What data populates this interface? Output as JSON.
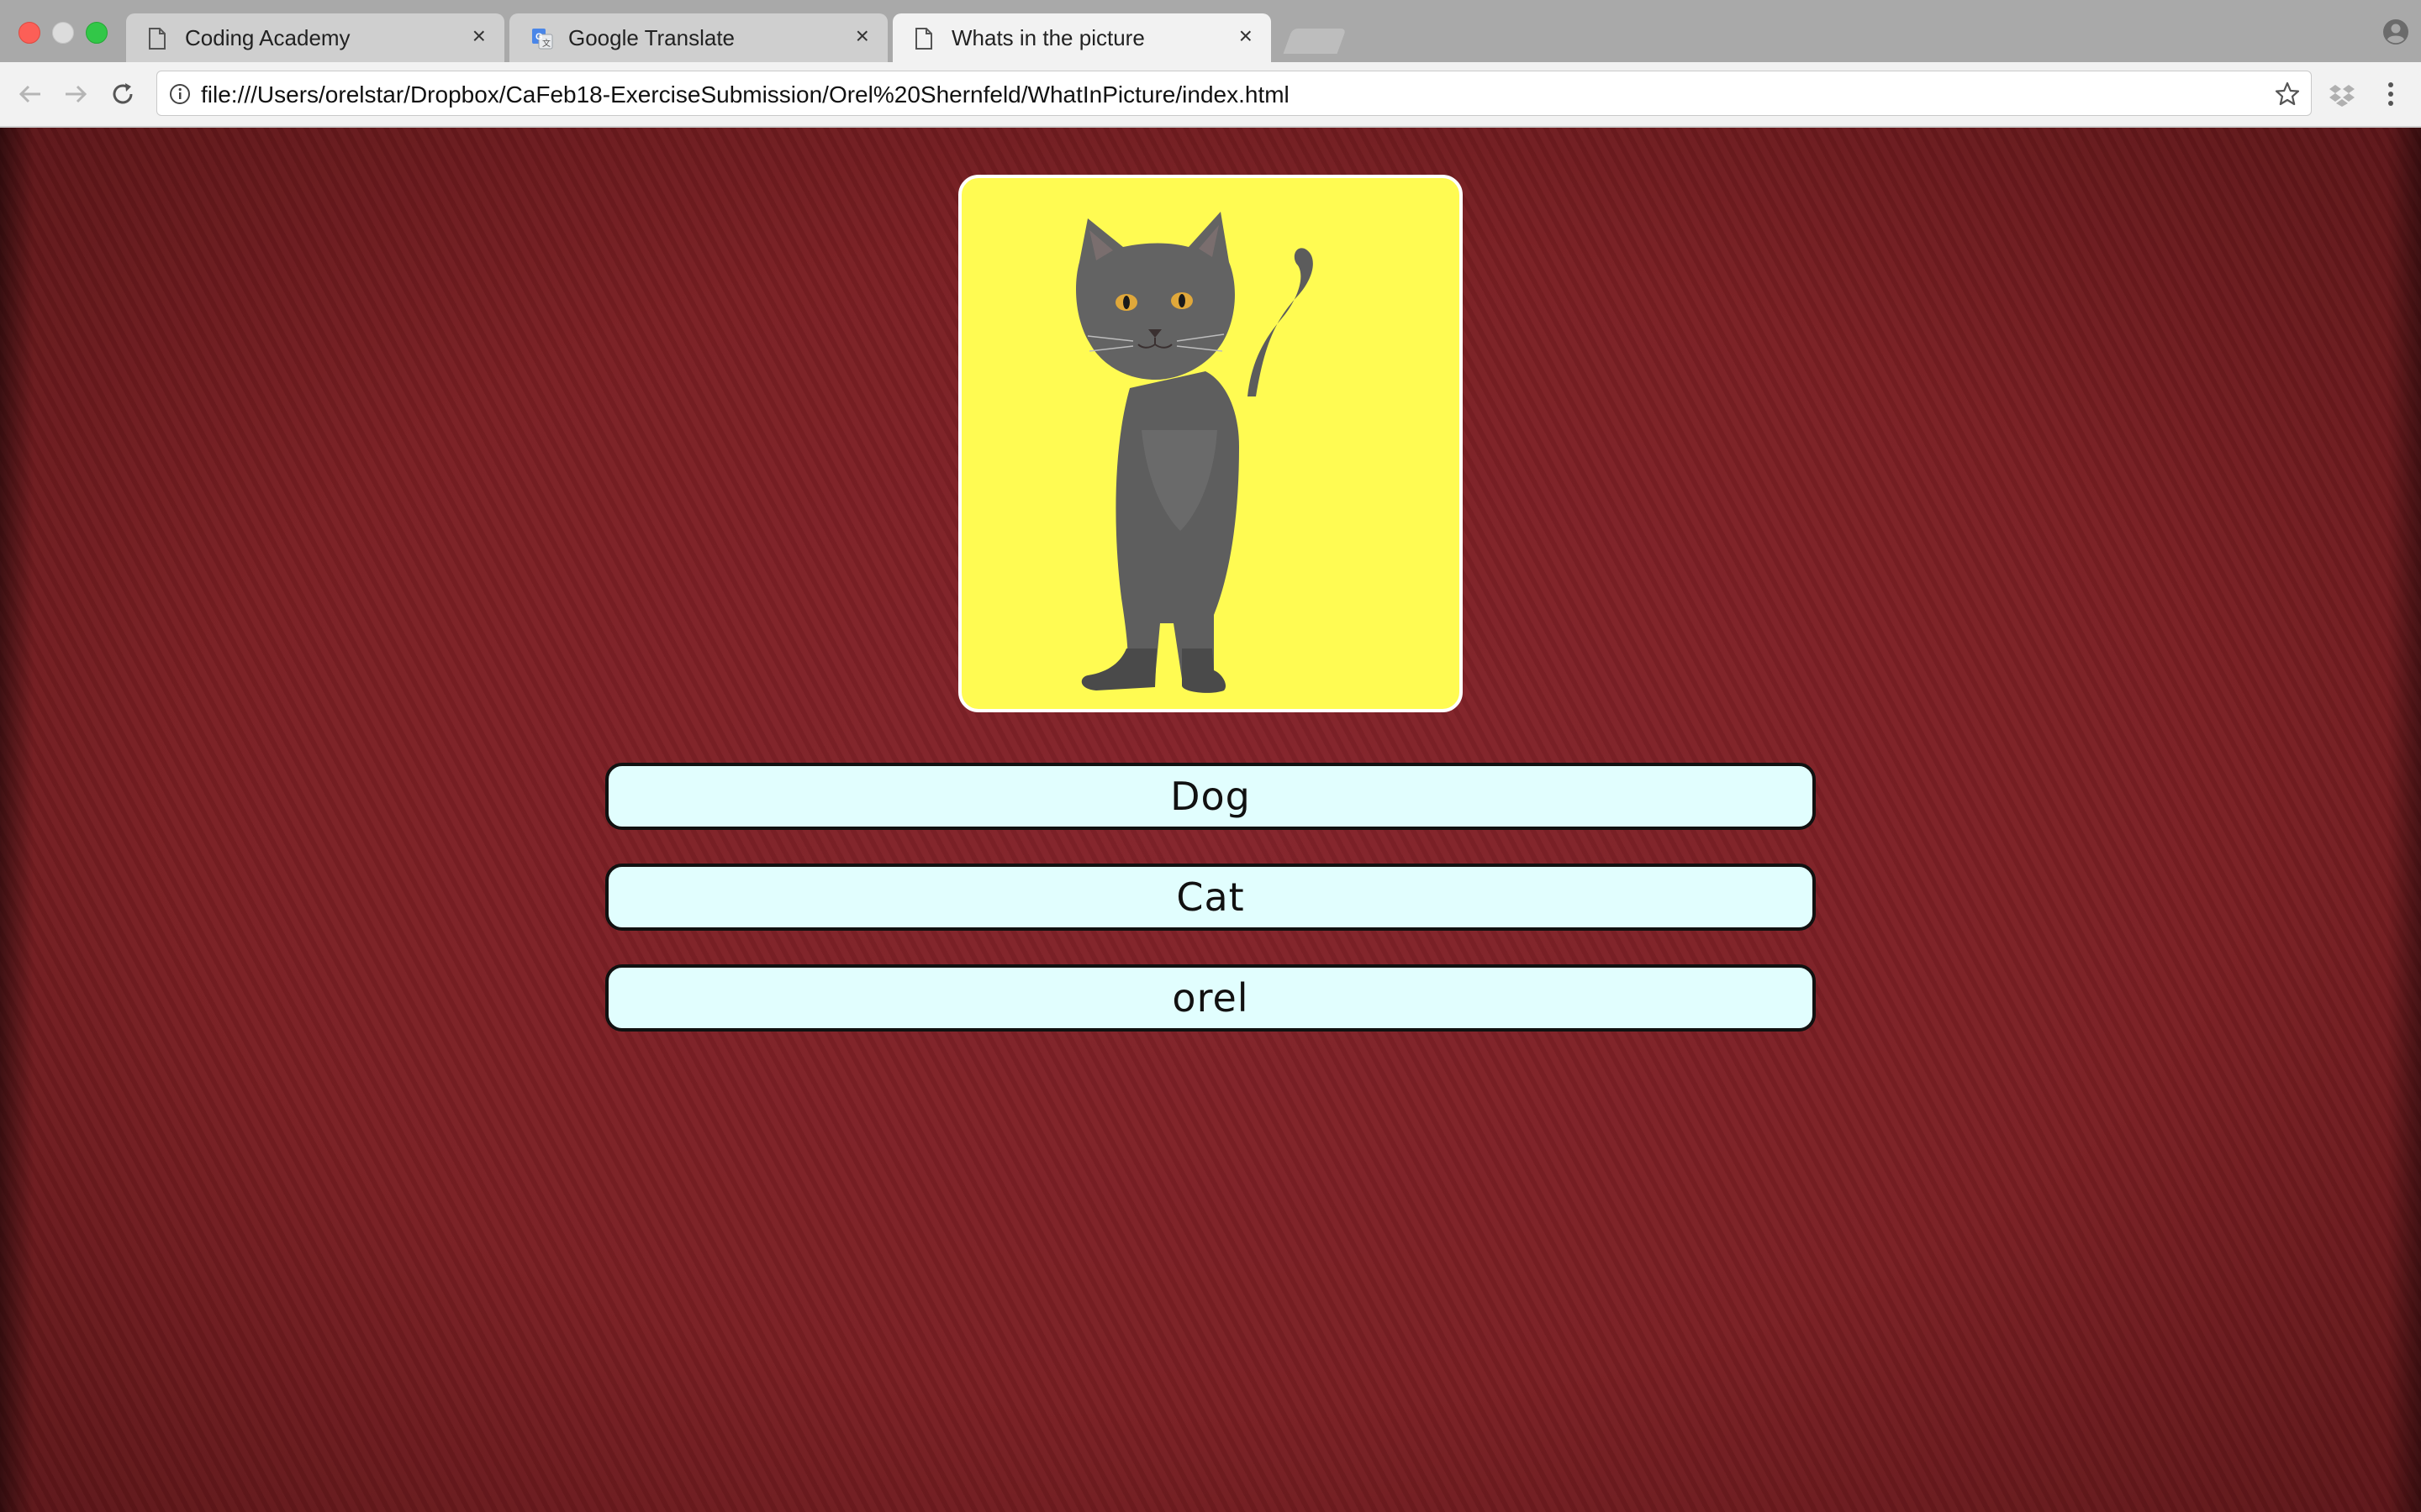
{
  "browser": {
    "tabs": [
      {
        "title": "Coding Academy",
        "icon": "document-icon",
        "active": false
      },
      {
        "title": "Google Translate",
        "icon": "google-translate-icon",
        "active": false
      },
      {
        "title": "Whats in the picture",
        "icon": "document-icon",
        "active": true
      }
    ],
    "close_glyph": "×",
    "address_bar": {
      "url": "file:///Users/orelstar/Dropbox/CaFeb18-ExerciseSubmission/Orel%20Shernfeld/WhatInPicture/index.html"
    }
  },
  "game": {
    "picture": {
      "subject_icon": "cat-image",
      "background_color": "#fffb52"
    },
    "answers": [
      {
        "label": "Dog"
      },
      {
        "label": "Cat"
      },
      {
        "label": "orel"
      }
    ]
  }
}
